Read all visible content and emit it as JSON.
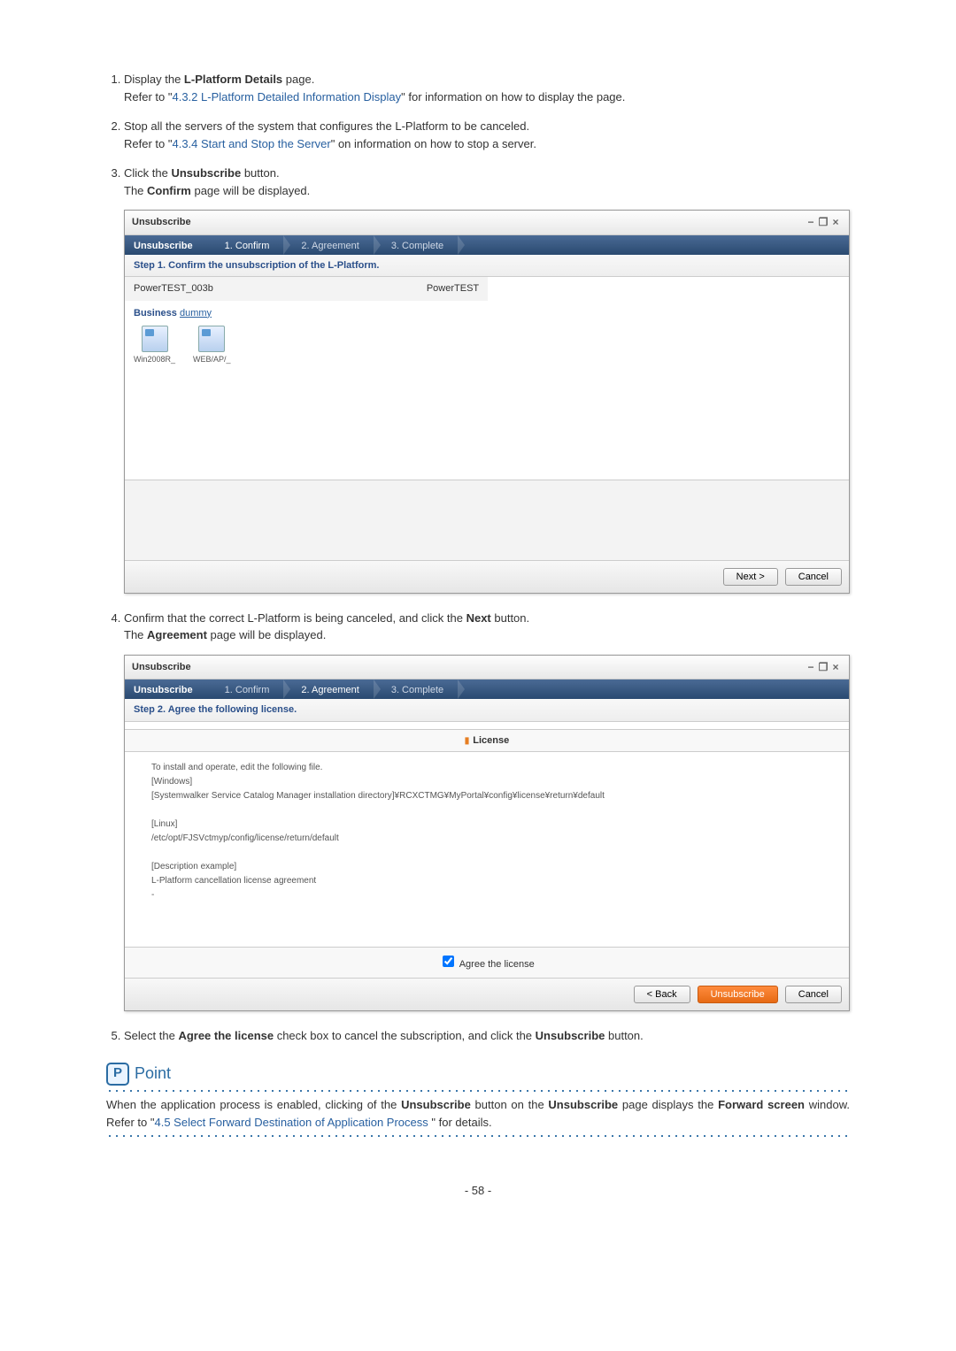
{
  "steps": {
    "s1_a": "Display the ",
    "s1_b": "L-Platform Details",
    "s1_c": " page.",
    "s1_d": "Refer to \"",
    "s1_link": "4.3.2 L-Platform Detailed Information Display",
    "s1_e": "\" for information on how to display the page.",
    "s2_a": "Stop all the servers of the system that configures the L-Platform to be canceled.",
    "s2_b": "Refer to \"",
    "s2_link": "4.3.4 Start and Stop the Server",
    "s2_c": "\" on information on how to stop a server.",
    "s3_a": "Click the ",
    "s3_b": "Unsubscribe",
    "s3_c": " button.",
    "s3_d": "The ",
    "s3_e": "Confirm",
    "s3_f": " page will be displayed."
  },
  "shot1": {
    "title": "Unsubscribe",
    "wiz_title": "Unsubscribe",
    "step1": "1. Confirm",
    "step2": "2. Agreement",
    "step3": "3. Complete",
    "stepdesc": "Step 1. Confirm the unsubscription of the L-Platform.",
    "col_left": "PowerTEST_003b",
    "col_right": "PowerTEST",
    "business": "Business",
    "dummy": "dummy",
    "srv1": "Win2008R_",
    "srv2": "WEB/AP/_",
    "next": "Next >",
    "cancel": "Cancel"
  },
  "mid": {
    "a": "Confirm that the correct L-Platform is being canceled, and click the ",
    "b": "Next",
    "c": " button.",
    "d": "The ",
    "e": "Agreement",
    "f": " page will be displayed."
  },
  "shot2": {
    "title": "Unsubscribe",
    "wiz_title": "Unsubscribe",
    "step1": "1. Confirm",
    "step2": "2. Agreement",
    "step3": "3. Complete",
    "stepdesc": "Step 2. Agree the following license.",
    "license_header": "License",
    "l1": "To install and operate, edit the following file.",
    "l2": "[Windows]",
    "l3": "[Systemwalker Service Catalog Manager installation directory]¥RCXCTMG¥MyPortal¥config¥license¥return¥default",
    "l4": "[Linux]",
    "l5": "/etc/opt/FJSVctmyp/config/license/return/default",
    "l6": "[Description example]",
    "l7": "L-Platform cancellation license agreement",
    "agree": "Agree the license",
    "back": "< Back",
    "unsubscribe": "Unsubscribe",
    "cancel": "Cancel"
  },
  "step5": {
    "a": "Select the ",
    "b": "Agree the license",
    "c": " check box to cancel the subscription, and click the ",
    "d": "Unsubscribe",
    "e": " button."
  },
  "point": {
    "label": "Point",
    "t1": "When the application process is enabled, clicking of the ",
    "t2": "Unsubscribe",
    "t3": " button on the ",
    "t4": "Unsubscribe",
    "t5": " page displays the ",
    "t6": "Forward screen",
    "t7": " window. Refer to \"",
    "link": "4.5 Select Forward Destination of Application Process",
    "t8": " \" for details."
  },
  "page_num": "- 58 -"
}
